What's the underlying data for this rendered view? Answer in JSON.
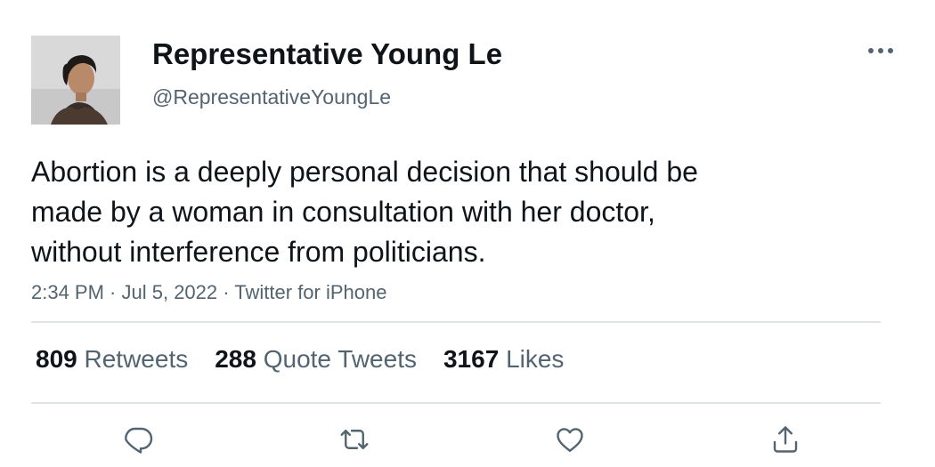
{
  "author": {
    "display_name": "Representative Young Le",
    "handle": "@RepresentativeYoungLe"
  },
  "tweet": {
    "text_lines": [
      "Abortion is a deeply personal decision that should be",
      "made by a woman in consultation with her doctor,",
      "without interference from politicians."
    ],
    "time": "2:34 PM",
    "separator": " · ",
    "date": "Jul 5, 2022",
    "source": "Twitter for iPhone"
  },
  "stats": {
    "retweets": {
      "count": "809",
      "label": "Retweets"
    },
    "quotes": {
      "count": "288",
      "label": "Quote Tweets"
    },
    "likes": {
      "count": "3167",
      "label": "Likes"
    }
  },
  "icons": {
    "more": "more-horizontal-icon",
    "reply": "reply-icon",
    "retweet": "retweet-icon",
    "like": "heart-icon",
    "share": "share-icon"
  },
  "colors": {
    "text_primary": "#0f1419",
    "text_secondary": "#536471",
    "divider": "#e1e4e6"
  }
}
